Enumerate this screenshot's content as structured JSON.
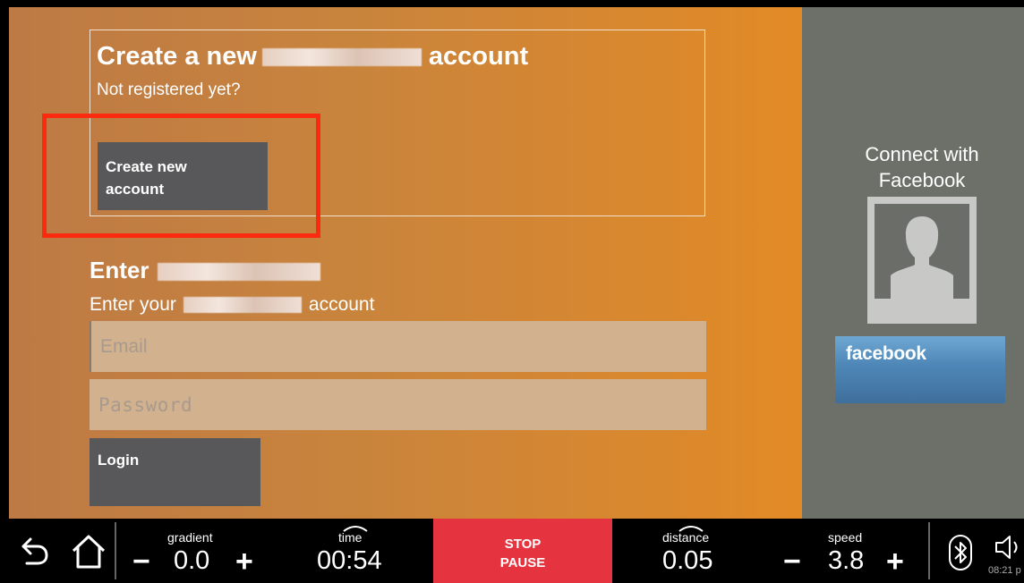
{
  "create": {
    "title_before": "Create a new",
    "title_after": "account",
    "subtitle": "Not registered yet?",
    "button_label_line1": "Create new",
    "button_label_line2": "account"
  },
  "login": {
    "title": "Enter",
    "subtitle_before": "Enter your",
    "subtitle_after": "account",
    "email_placeholder": "Email",
    "password_placeholder": "Password",
    "button_label": "Login"
  },
  "facebook": {
    "connect_line1": "Connect with",
    "connect_line2": "Facebook",
    "button_label": "facebook"
  },
  "bottom_bar": {
    "gradient_label": "gradient",
    "gradient_value": "0.0",
    "time_label": "time",
    "time_value": "00:54",
    "stop_label": "STOP",
    "pause_label": "PAUSE",
    "distance_label": "distance",
    "distance_value": "0.05",
    "speed_label": "speed",
    "speed_value": "3.8",
    "minus": "−",
    "plus": "+",
    "clock": "08:21 p"
  },
  "colors": {
    "highlight": "#fc2a0f",
    "stop_button": "#e5343f",
    "panel_orange": "#e28a26",
    "panel_gray": "#6d7068"
  },
  "icons": [
    "back-icon",
    "home-icon",
    "bluetooth-icon",
    "volume-icon",
    "avatar-placeholder-icon"
  ]
}
